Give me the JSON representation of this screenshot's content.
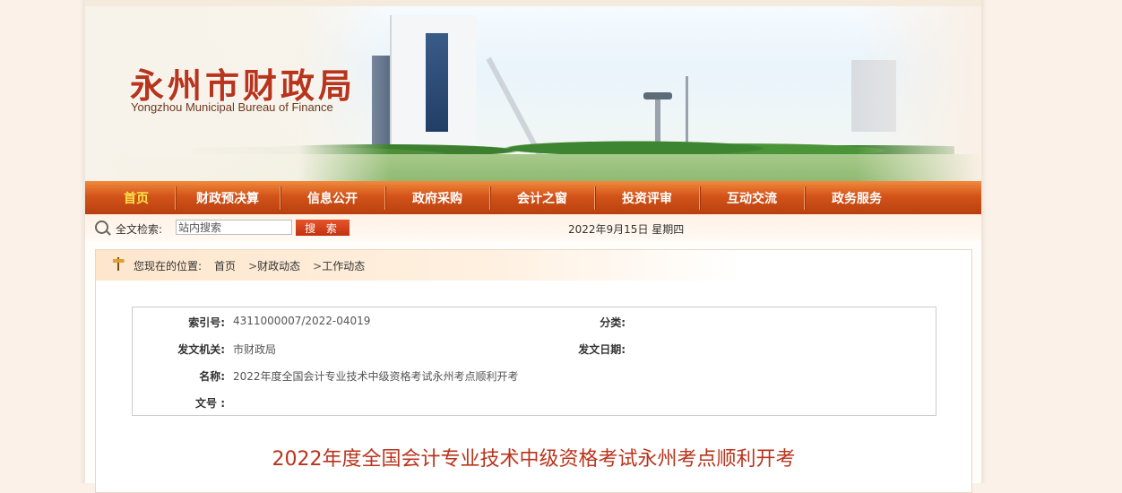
{
  "header": {
    "title": "永州市财政局",
    "subtitle": "Yongzhou Municipal Bureau of Finance"
  },
  "nav": {
    "items": [
      {
        "label": "首页",
        "active": true
      },
      {
        "label": "财政预决算"
      },
      {
        "label": "信息公开"
      },
      {
        "label": "政府采购"
      },
      {
        "label": "会计之窗"
      },
      {
        "label": "投资评审"
      },
      {
        "label": "互动交流"
      },
      {
        "label": "政务服务"
      }
    ]
  },
  "search": {
    "label": "全文检索:",
    "placeholder": "站内搜索",
    "button_label": "搜 索"
  },
  "date": "2022年9月15日 星期四",
  "breadcrumb": {
    "prefix": "您现在的位置:",
    "items": [
      "首页",
      "财政动态",
      "工作动态"
    ],
    "separator": ">"
  },
  "meta": {
    "index_label": "索引号:",
    "index_value": "4311000007/2022-04019",
    "category_label": "分类:",
    "category_value": "",
    "issuer_label": "发文机关:",
    "issuer_value": "市财政局",
    "date_label": "发文日期:",
    "date_value": "",
    "name_label": "名称:",
    "name_value": "2022年度全国会计专业技术中级资格考试永州考点顺利开考",
    "docno_label": "文号 :",
    "docno_value": ""
  },
  "article": {
    "title": "2022年度全国会计专业技术中级资格考试永州考点顺利开考"
  },
  "colors": {
    "brand_red": "#b8341c",
    "nav_orange": "#d3541a",
    "nav_active": "#ffe34a",
    "background": "#fbf1e8"
  }
}
